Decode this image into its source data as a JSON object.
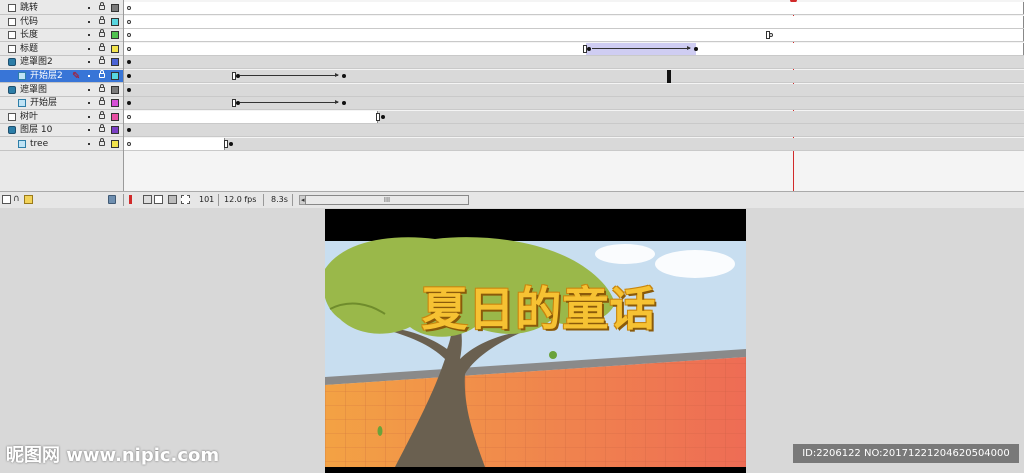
{
  "timeline": {
    "layers": [
      {
        "name": "跳转",
        "type": "normal",
        "color": "#7a7a7a",
        "indent": false,
        "selected": false
      },
      {
        "name": "代码",
        "type": "normal",
        "color": "#57d6e0",
        "indent": false,
        "selected": false
      },
      {
        "name": "长度",
        "type": "normal",
        "color": "#4fc24f",
        "indent": false,
        "selected": false
      },
      {
        "name": "标题",
        "type": "normal",
        "color": "#f2e34d",
        "indent": false,
        "selected": false
      },
      {
        "name": "遮罩图2",
        "type": "mask",
        "color": "#4a63d6",
        "indent": false,
        "selected": false
      },
      {
        "name": "开始层2",
        "type": "masked",
        "color": "#57d6e0",
        "indent": true,
        "selected": true
      },
      {
        "name": "遮罩图",
        "type": "mask",
        "color": "#7a7a7a",
        "indent": false,
        "selected": false
      },
      {
        "name": "开始层",
        "type": "masked",
        "color": "#d64fd6",
        "indent": true,
        "selected": false
      },
      {
        "name": "树叶",
        "type": "normal",
        "color": "#e84fa3",
        "indent": false,
        "selected": false
      },
      {
        "name": "图层 10",
        "type": "mask",
        "color": "#7a3fc4",
        "indent": false,
        "selected": false
      },
      {
        "name": "tree",
        "type": "masked",
        "color": "#f2e34d",
        "indent": true,
        "selected": false
      }
    ],
    "current_frame": "101",
    "frame_rate": "12.0 fps",
    "elapsed_time": "8.3s",
    "scroll_thumb_label": "III"
  },
  "stage": {
    "title": "夏日的童话",
    "colors": {
      "sky": "#c8def0",
      "foliage": "#9ab84a",
      "trunk": "#6a6050",
      "wall_left": "#f3a244",
      "wall_right": "#ee6c55",
      "title_fill": "#f6c233"
    }
  },
  "watermark": {
    "left": "昵图网 www.nipic.com",
    "right": "ID:2206122 NO:20171221204620504000"
  }
}
